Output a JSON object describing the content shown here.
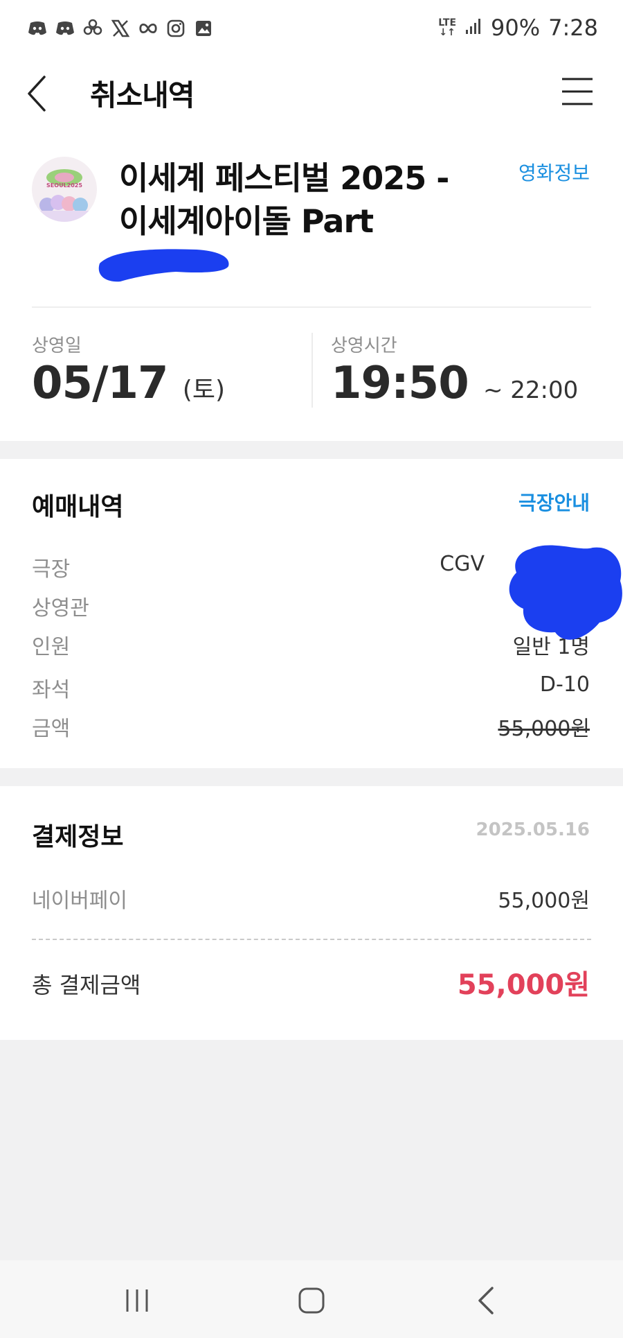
{
  "status_bar": {
    "left_icons": [
      "discord-icon",
      "discord-icon",
      "flower-icon",
      "x-logo-icon",
      "infinity-icon",
      "instagram-icon",
      "gallery-icon"
    ],
    "network": "LTE",
    "battery": "90%",
    "time": "7:28"
  },
  "header": {
    "title": "취소내역",
    "back_icon": "chevron-left-icon",
    "menu_icon": "hamburger-menu-icon"
  },
  "movie": {
    "title_line1": "이세계 페스티벌 2025 -",
    "title_line2": "이세계아이돌 Part",
    "info_link": "영화정보",
    "poster_text": "SEOUL2025",
    "date_label": "상영일",
    "date": "05/17",
    "day": "(토)",
    "time_label": "상영시간",
    "start_time": "19:50",
    "end_time": "~ 22:00"
  },
  "booking": {
    "title": "예매내역",
    "link": "극장안내",
    "rows": [
      {
        "label": "극장",
        "value": "CGV"
      },
      {
        "label": "상영관",
        "value": ""
      },
      {
        "label": "인원",
        "value": "일반 1명"
      },
      {
        "label": "좌석",
        "value": "D-10"
      },
      {
        "label": "금액",
        "value": "55,000원"
      }
    ]
  },
  "payment": {
    "title": "결제정보",
    "date": "2025.05.16",
    "method_label": "네이버페이",
    "method_value": "55,000원",
    "total_label": "총 결제금액",
    "total_value": "55,000원"
  },
  "nav": {
    "icons": [
      "recent-apps-icon",
      "home-icon",
      "back-icon"
    ]
  },
  "colors": {
    "link_blue": "#1a8fe0",
    "total_red": "#e2415a",
    "redaction_blue": "#1b3ff0"
  }
}
